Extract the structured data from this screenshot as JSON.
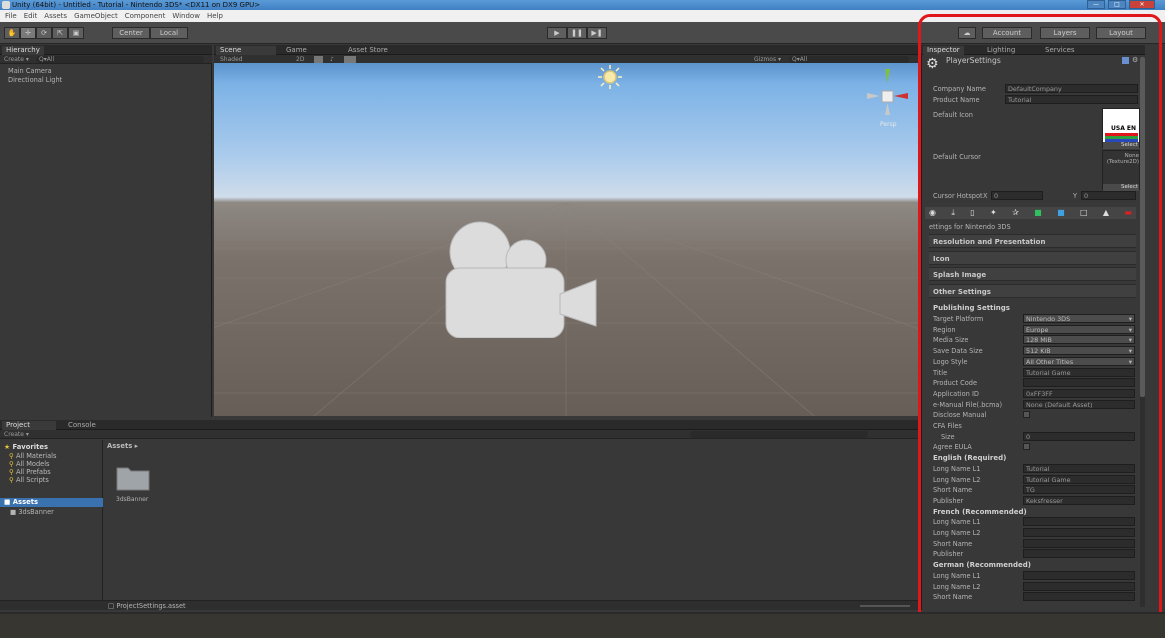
{
  "window": {
    "title": "Unity (64bit) - Untitled - Tutorial - Nintendo 3DS* <DX11 on DX9 GPU>"
  },
  "menu": [
    "File",
    "Edit",
    "Assets",
    "GameObject",
    "Component",
    "Window",
    "Help"
  ],
  "toolbar": {
    "center": "Center",
    "local": "Local",
    "account": "Account",
    "layers": "Layers",
    "layout": "Layout"
  },
  "hierarchy": {
    "tab": "Hierarchy",
    "create": "Create ▾",
    "search_placeholder": "Q▾All",
    "items": [
      "Main Camera",
      "Directional Light"
    ]
  },
  "scene": {
    "tabs": [
      "Scene",
      "Game",
      "Asset Store"
    ],
    "shaded": "Shaded",
    "mode_2d": "2D",
    "gizmos": "Gizmos ▾",
    "gizmos_search": "Q▾All",
    "persp": "Persp"
  },
  "project": {
    "tabs": [
      "Project",
      "Console"
    ],
    "create": "Create ▾",
    "favorites": "Favorites",
    "fav_items": [
      "All Materials",
      "All Models",
      "All Prefabs",
      "All Scripts"
    ],
    "assets_tree": "Assets",
    "tree_child": "3dsBanner",
    "breadcrumb": "Assets ▸",
    "folder": "3dsBanner",
    "status_file": "ProjectSettings.asset"
  },
  "inspector": {
    "tabs": [
      "Inspector",
      "Lighting",
      "Services"
    ],
    "title": "PlayerSettings",
    "company_label": "Company Name",
    "company_value": "DefaultCompany",
    "product_label": "Product Name",
    "product_value": "Tutorial",
    "default_icon": "Default Icon",
    "icon_text": "USA EN",
    "select": "Select",
    "default_cursor": "Default Cursor",
    "cursor_none": "None",
    "cursor_type": "(Texture2D)",
    "cursor_hotspot": "Cursor Hotspot",
    "x_label": "X",
    "x_value": "0",
    "y_label": "Y",
    "y_value": "0",
    "platform_settings": "ettings for Nintendo 3DS",
    "sections": [
      "Resolution and Presentation",
      "Icon",
      "Splash Image",
      "Other Settings"
    ],
    "publishing": "Publishing Settings",
    "fields": [
      {
        "label": "Target Platform",
        "value": "Nintendo 3DS",
        "dropdown": true
      },
      {
        "label": "Region",
        "value": "Europe",
        "dropdown": true
      },
      {
        "label": "Media Size",
        "value": "128 MiB",
        "dropdown": true
      },
      {
        "label": "Save Data Size",
        "value": "512 KiB",
        "dropdown": true
      },
      {
        "label": "Logo Style",
        "value": "All Other Titles",
        "dropdown": true
      },
      {
        "label": "Title",
        "value": "Tutorial Game"
      },
      {
        "label": "Product Code",
        "value": ""
      },
      {
        "label": "Application ID",
        "value": "0xFF3FF"
      },
      {
        "label": "e-Manual File(.bcma)",
        "value": "None (Default Asset)"
      },
      {
        "label": "Disclose Manual",
        "value": ""
      },
      {
        "label": "CFA Files",
        "value": ""
      },
      {
        "label": "Size",
        "value": "0"
      },
      {
        "label": "Agree EULA",
        "value": ""
      }
    ],
    "english_header": "English (Required)",
    "english": [
      {
        "label": "Long Name L1",
        "value": "Tutorial"
      },
      {
        "label": "Long Name L2",
        "value": "Tutorial Game"
      },
      {
        "label": "Short Name",
        "value": "TG"
      },
      {
        "label": "Publisher",
        "value": "Keksfresser"
      }
    ],
    "french_header": "French (Recommended)",
    "french": [
      {
        "label": "Long Name L1",
        "value": ""
      },
      {
        "label": "Long Name L2",
        "value": ""
      },
      {
        "label": "Short Name",
        "value": ""
      },
      {
        "label": "Publisher",
        "value": ""
      }
    ],
    "german_header": "German (Recommended)",
    "german": [
      {
        "label": "Long Name L1",
        "value": ""
      },
      {
        "label": "Long Name L2",
        "value": ""
      },
      {
        "label": "Short Name",
        "value": ""
      }
    ]
  },
  "colors": {
    "highlight": "#e0161b",
    "panel": "#383838",
    "selection": "#3a72b0",
    "gizmo_y": "#80c040",
    "gizmo_x": "#d03030"
  }
}
